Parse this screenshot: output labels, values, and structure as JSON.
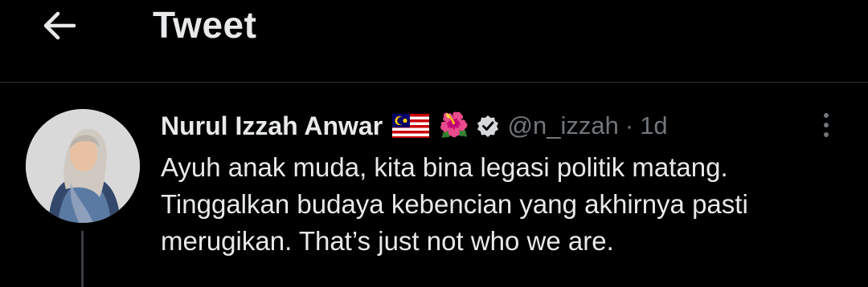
{
  "header": {
    "back_icon": "arrow-left-icon",
    "title": "Tweet"
  },
  "tweet": {
    "author": {
      "name": "Nurul Izzah Anwar",
      "handle": "@n_izzah",
      "emoji_flag": "malaysia-flag-icon",
      "emoji_flower": "🌺",
      "verified_icon": "verified-badge-icon"
    },
    "separator": "·",
    "time": "1d",
    "more_icon": "more-vertical-icon",
    "text_lines": [
      "Ayuh anak muda, kita bina legasi politik matang.",
      "Tinggalkan budaya kebencian yang akhirnya pasti",
      "merugikan. That’s just not who we are."
    ]
  },
  "colors": {
    "background": "#000000",
    "text": "#e7e9ea",
    "secondary": "#71767b",
    "divider": "#2f3336"
  }
}
